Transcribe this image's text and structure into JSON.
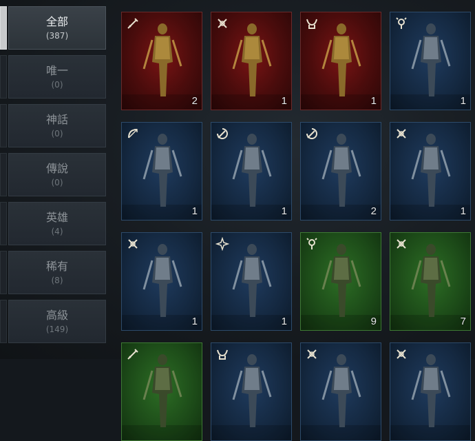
{
  "categories": [
    {
      "name": "全部",
      "count": "(387)",
      "active": true
    },
    {
      "name": "唯一",
      "count": "(0)"
    },
    {
      "name": "神話",
      "count": "(0)"
    },
    {
      "name": "傳說",
      "count": "(0)"
    },
    {
      "name": "英雄",
      "count": "(4)"
    },
    {
      "name": "稀有",
      "count": "(8)"
    },
    {
      "name": "高級",
      "count": "(149)"
    }
  ],
  "cards": [
    {
      "rarity": "red",
      "icon": "sword-icon",
      "qty": "2"
    },
    {
      "rarity": "red",
      "icon": "crossed-blades-icon",
      "qty": "1"
    },
    {
      "rarity": "red",
      "icon": "horned-helm-icon",
      "qty": "1"
    },
    {
      "rarity": "blue",
      "icon": "mage-orb-icon",
      "qty": "1"
    },
    {
      "rarity": "blue",
      "icon": "bow-icon",
      "qty": "1"
    },
    {
      "rarity": "blue",
      "icon": "blade-whirl-icon",
      "qty": "1"
    },
    {
      "rarity": "blue",
      "icon": "blade-whirl-icon",
      "qty": "2"
    },
    {
      "rarity": "blue",
      "icon": "crossed-blades-icon",
      "qty": "1"
    },
    {
      "rarity": "blue",
      "icon": "crossed-blades-icon",
      "qty": "1"
    },
    {
      "rarity": "blue",
      "icon": "star-burst-icon",
      "qty": "1"
    },
    {
      "rarity": "green",
      "icon": "mage-orb-icon",
      "qty": "9"
    },
    {
      "rarity": "green",
      "icon": "crossed-blades-icon",
      "qty": "7"
    },
    {
      "rarity": "green",
      "icon": "sword-icon",
      "qty": ""
    },
    {
      "rarity": "blue",
      "icon": "horned-helm-icon",
      "qty": ""
    },
    {
      "rarity": "blue",
      "icon": "crossed-blades-icon",
      "qty": ""
    },
    {
      "rarity": "blue",
      "icon": "crossed-blades-icon",
      "qty": ""
    }
  ],
  "colors": {
    "red": "#7a1414",
    "blue": "#1f3b5e",
    "green": "#2d6e25",
    "active_tab": "#c7c9cb"
  }
}
